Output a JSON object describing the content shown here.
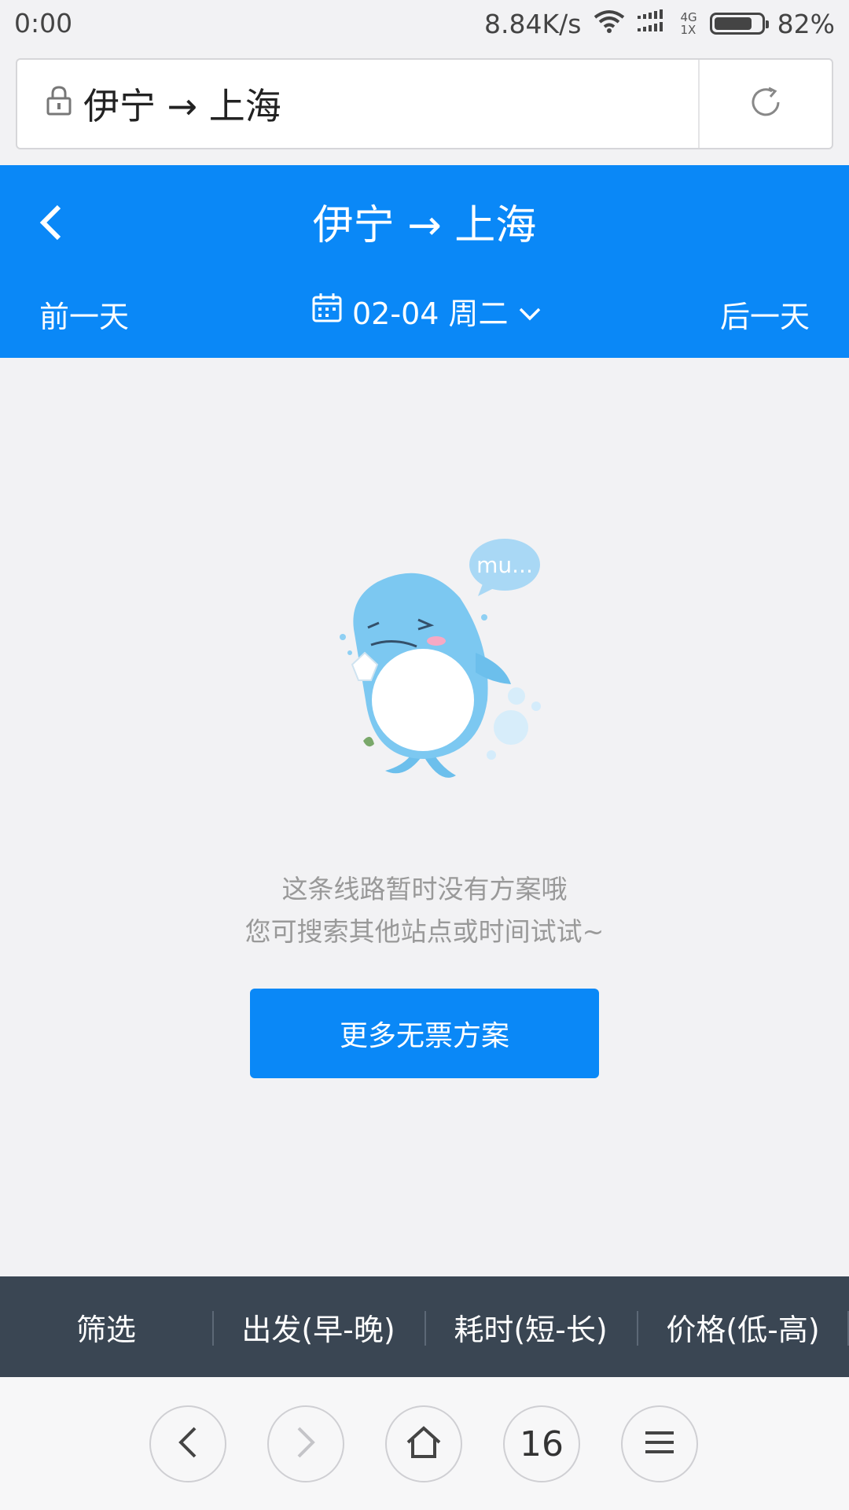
{
  "status_bar": {
    "time": "0:00",
    "network_speed": "8.84K/s",
    "network_type_top": "4G",
    "network_type_bottom": "1X",
    "battery_percent": "82%",
    "battery_level": 0.82
  },
  "address_bar": {
    "url_text": "伊宁 → 上海"
  },
  "header": {
    "title": "伊宁 → 上海",
    "prev_day": "前一天",
    "next_day": "后一天",
    "date": "02-04 周二",
    "accent_color": "#0a88f7"
  },
  "empty_state": {
    "mascot_bubble": "mu...",
    "line1": "这条线路暂时没有方案哦",
    "line2": "您可搜索其他站点或时间试试~",
    "button_label": "更多无票方案"
  },
  "sort_bar": {
    "items": [
      {
        "label": "筛选"
      },
      {
        "label": "出发(早-晚)"
      },
      {
        "label": "耗时(短-长)"
      },
      {
        "label": "价格(低-高)"
      }
    ]
  },
  "browser_nav": {
    "tab_count": "16",
    "icons": [
      "chevron-left-icon",
      "chevron-right-icon",
      "home-icon",
      "tab-count",
      "menu-icon"
    ]
  }
}
